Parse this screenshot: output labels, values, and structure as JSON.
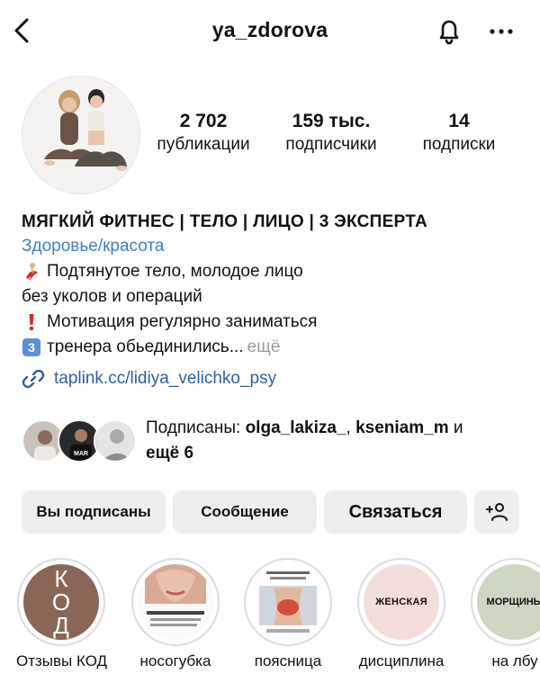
{
  "header": {
    "username": "ya_zdorova",
    "back_icon": "chevron-left-icon",
    "bell_icon": "bell-icon",
    "more_icon": "more-horizontal-icon"
  },
  "stats": [
    {
      "value": "2 702",
      "label": "публикации"
    },
    {
      "value": "159 тыс.",
      "label": "подписчики"
    },
    {
      "value": "14",
      "label": "подписки"
    }
  ],
  "bio": {
    "name": "МЯГКИЙ ФИТНЕС | ТЕЛО | ЛИЦО | 3 ЭКСПЕРТА",
    "category": "Здоровье/красота",
    "line1": "Подтянутое тело, молодое лицо",
    "line2": "без уколов и операций",
    "line3": "Мотивация регулярно заниматься",
    "line4": "тренера обьединились...",
    "more": "ещё",
    "link": "taplink.cc/lidiya_velichko_psy"
  },
  "followed_by": {
    "prefix": "Подписаны: ",
    "user1": "olga_lakiza_",
    "separator": ", ",
    "user2": "kseniam_m",
    "suffix": " и",
    "more": "ещё 6"
  },
  "buttons": {
    "following": "Вы подписаны",
    "message": "Сообщение",
    "contact": "Связаться"
  },
  "highlights": [
    {
      "label": "Отзывы КОД",
      "cover_text": "КОД"
    },
    {
      "label": "носогубка",
      "cover_text": ""
    },
    {
      "label": "поясница",
      "cover_text": ""
    },
    {
      "label": "дисциплина",
      "cover_text": "ЖЕНСКАЯ"
    },
    {
      "label": "на лбу",
      "cover_text": "МОРЩИНЫ"
    }
  ],
  "colors": {
    "link": "#2d5f9e",
    "category": "#3f7cc8",
    "button_bg": "#eeeeee"
  }
}
